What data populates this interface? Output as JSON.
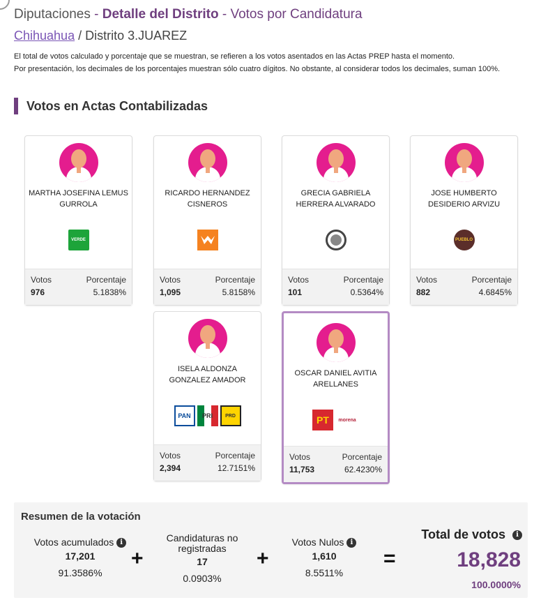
{
  "header": {
    "section": "Diputaciones",
    "sep1": " - ",
    "detail": "Detalle del Distrito",
    "sep2": " - ",
    "subtitle": "Votos por Candidatura"
  },
  "breadcrumb": {
    "state": "Chihuahua",
    "sep": " / ",
    "district": "Distrito 3.JUAREZ"
  },
  "note": {
    "line1": "El total de votos calculado y porcentaje que se muestran, se refieren a los votos asentados en las Actas PREP hasta el momento.",
    "line2": "Por presentación, los decimales de los porcentajes muestran sólo cuatro dígitos. No obstante, al considerar todos los decimales, suman 100%."
  },
  "section_title": "Votos en Actas Contabilizadas",
  "labels": {
    "votos": "Votos",
    "porcentaje": "Porcentaje"
  },
  "candidates": [
    {
      "name": "MARTHA JOSEFINA LEMUS GURROLA",
      "votes": "976",
      "pct": "5.1838%",
      "parties": [
        "VERDE"
      ]
    },
    {
      "name": "RICARDO HERNANDEZ CISNEROS",
      "votes": "1,095",
      "pct": "5.8158%",
      "parties": [
        "MOVIMIENTO CIUDADANO"
      ]
    },
    {
      "name": "GRECIA GABRIELA HERRERA ALVARADO",
      "votes": "101",
      "pct": "0.5364%",
      "parties": [
        "circle"
      ]
    },
    {
      "name": "JOSE HUMBERTO DESIDERIO ARVIZU",
      "votes": "882",
      "pct": "4.6845%",
      "parties": [
        "PUEBLO"
      ]
    },
    {
      "name": "ISELA ALDONZA GONZALEZ AMADOR",
      "votes": "2,394",
      "pct": "12.7151%",
      "parties": [
        "PAN",
        "PRI",
        "PRD"
      ]
    },
    {
      "name": "OSCAR DANIEL AVITIA ARELLANES",
      "votes": "11,753",
      "pct": "62.4230%",
      "parties": [
        "PT",
        "morena"
      ]
    }
  ],
  "summary": {
    "title": "Resumen de la votación",
    "acumulados": {
      "label": "Votos acumulados",
      "value": "17,201",
      "pct": "91.3586%"
    },
    "no_registradas": {
      "label1": "Candidaturas no",
      "label2": "registradas",
      "value": "17",
      "pct": "0.0903%"
    },
    "nulos": {
      "label": "Votos Nulos",
      "value": "1,610",
      "pct": "8.5511%"
    },
    "total": {
      "label": "Total de votos",
      "value": "18,828",
      "pct": "100.0000%"
    },
    "plus": "+",
    "equals": "=",
    "info": "i"
  },
  "colors": {
    "accent": "#6f3f7f",
    "link": "#7a55b5",
    "avatar": "#e41d8e",
    "highlight_border": "#b48bc4"
  }
}
